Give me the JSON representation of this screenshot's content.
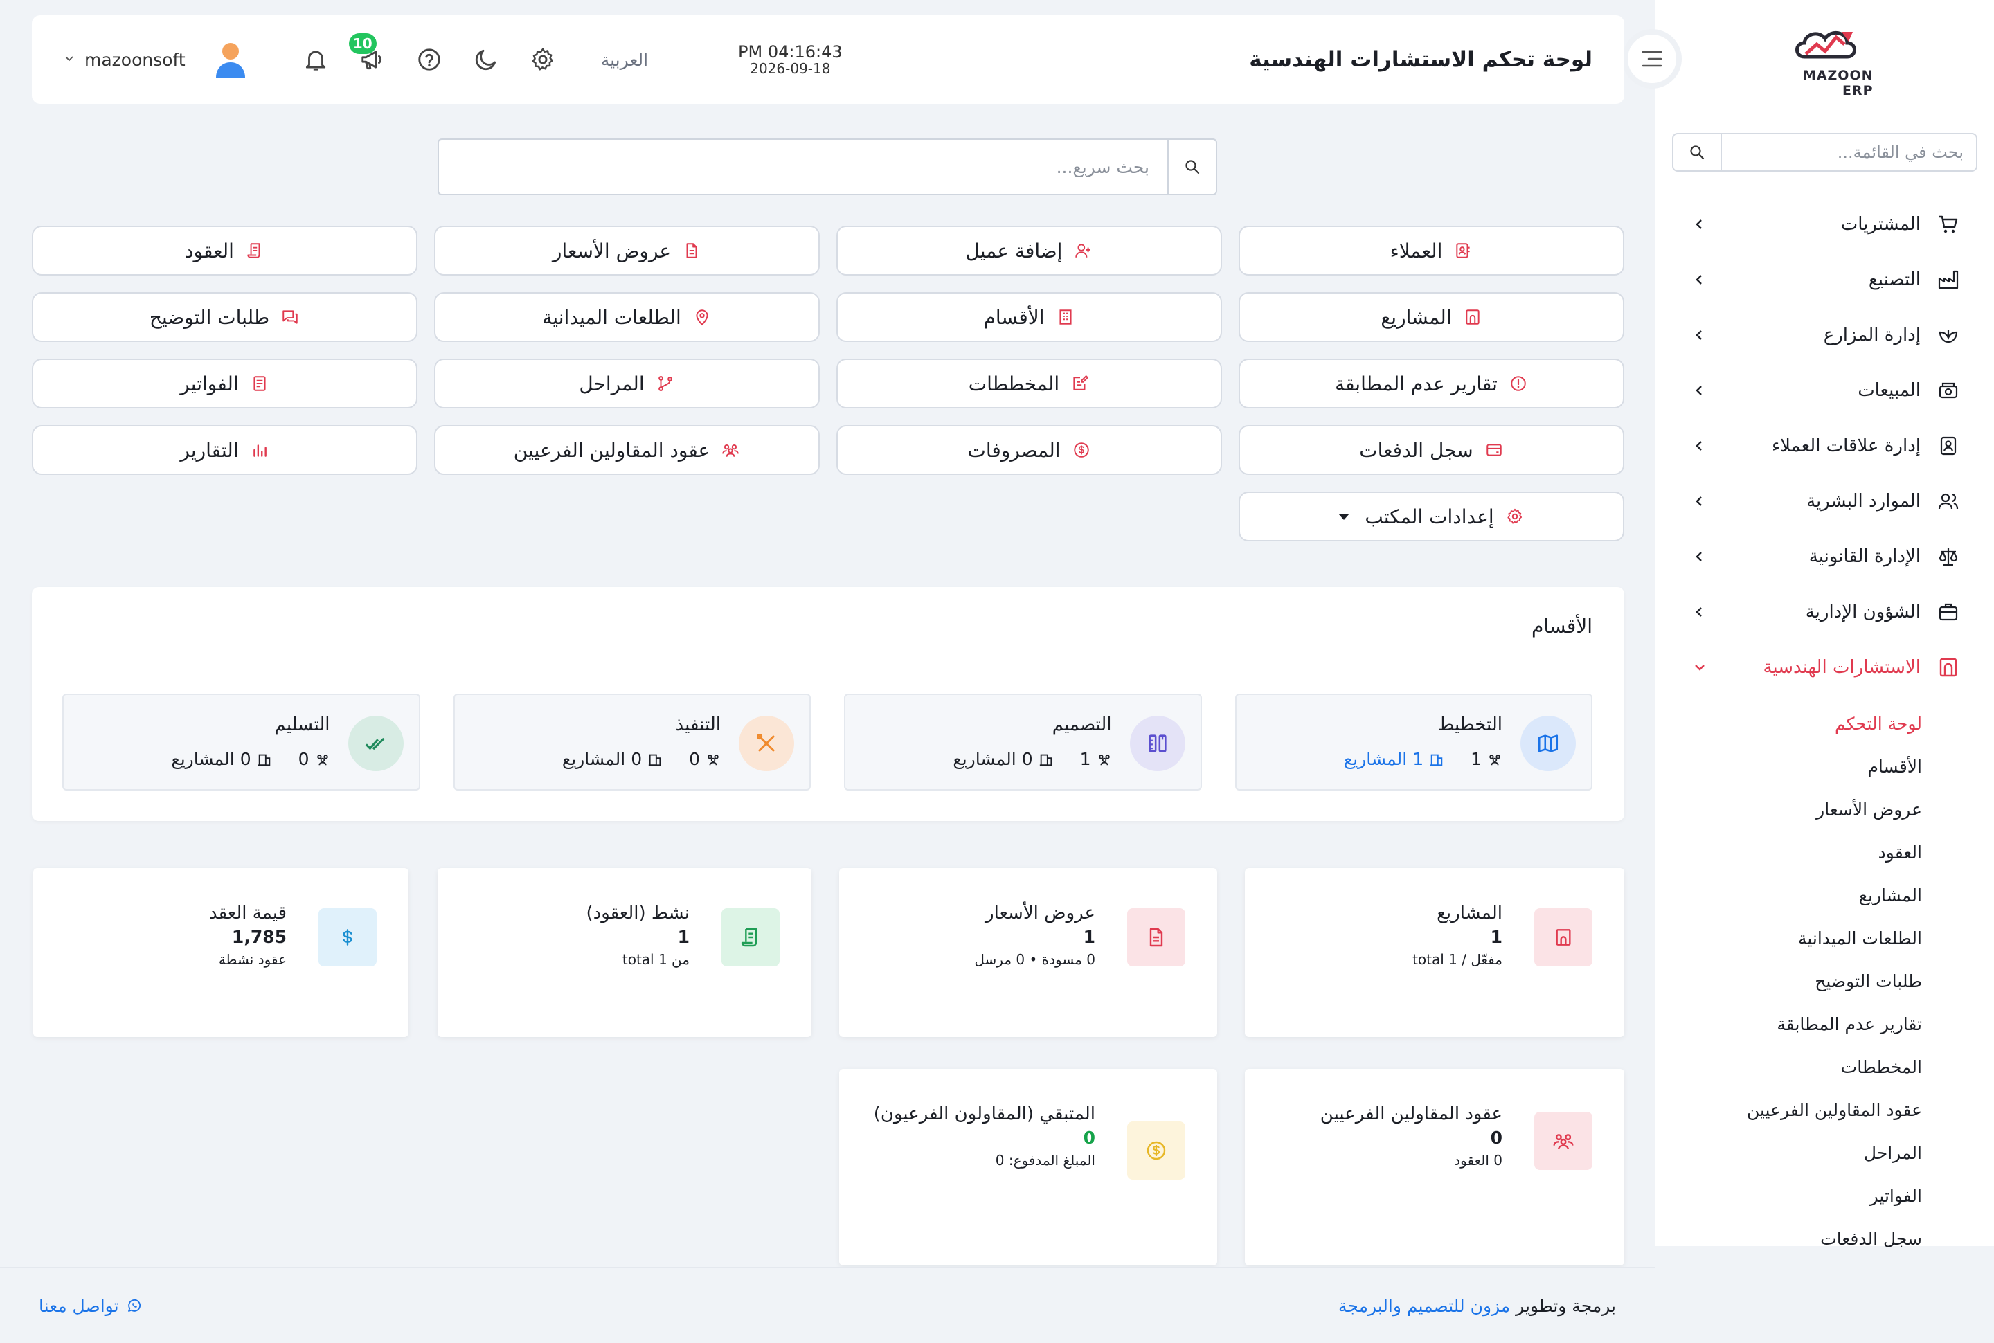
{
  "brand": {
    "logo_text": "MAZOON ERP",
    "logo_tagline": "ERP"
  },
  "sidebar": {
    "search_placeholder": "بحث في القائمة...",
    "items": [
      {
        "label": "المشتريات"
      },
      {
        "label": "التصنيع"
      },
      {
        "label": "إدارة المزارع"
      },
      {
        "label": "المبيعات"
      },
      {
        "label": "إدارة علاقات العملاء"
      },
      {
        "label": "الموارد البشرية"
      },
      {
        "label": "الإدارة القانونية"
      },
      {
        "label": "الشؤون الإدارية"
      },
      {
        "label": "الاستشارات الهندسية"
      }
    ],
    "subitems": [
      {
        "label": "لوحة التحكم"
      },
      {
        "label": "الأقسام"
      },
      {
        "label": "عروض الأسعار"
      },
      {
        "label": "العقود"
      },
      {
        "label": "المشاريع"
      },
      {
        "label": "الطلعات الميدانية"
      },
      {
        "label": "طلبات التوضيح"
      },
      {
        "label": "تقارير عدم المطابقة"
      },
      {
        "label": "المخططات"
      },
      {
        "label": "عقود المقاولين الفرعيين"
      },
      {
        "label": "المراحل"
      },
      {
        "label": "الفواتير"
      },
      {
        "label": "سجل الدفعات"
      }
    ]
  },
  "header": {
    "title": "لوحة تحكم الاستشارات الهندسية",
    "time": "PM 04:16:43",
    "date": "2026-09-18",
    "language": "العربية",
    "notification_count": "10",
    "username": "mazoonsoft"
  },
  "quick_search": {
    "placeholder": "بحث سريع..."
  },
  "quick_links": [
    {
      "label": "العملاء"
    },
    {
      "label": "إضافة عميل"
    },
    {
      "label": "عروض الأسعار"
    },
    {
      "label": "العقود"
    },
    {
      "label": "المشاريع"
    },
    {
      "label": "الأقسام"
    },
    {
      "label": "الطلعات الميدانية"
    },
    {
      "label": "طلبات التوضيح"
    },
    {
      "label": "تقارير عدم المطابقة"
    },
    {
      "label": "المخططات"
    },
    {
      "label": "المراحل"
    },
    {
      "label": "الفواتير"
    },
    {
      "label": "سجل الدفعات"
    },
    {
      "label": "المصروفات"
    },
    {
      "label": "عقود المقاولين الفرعيين"
    },
    {
      "label": "التقارير"
    },
    {
      "label": "إعدادات المكتب"
    }
  ],
  "departments": {
    "title": "الأقسام",
    "items": [
      {
        "name": "التخطيط",
        "people": "1",
        "projects": "1",
        "projects_label": "المشاريع"
      },
      {
        "name": "التصميم",
        "people": "1",
        "projects": "0",
        "projects_label": "المشاريع"
      },
      {
        "name": "التنفيذ",
        "people": "0",
        "projects": "0",
        "projects_label": "المشاريع"
      },
      {
        "name": "التسليم",
        "people": "0",
        "projects": "0",
        "projects_label": "المشاريع"
      }
    ]
  },
  "stats": [
    {
      "title": "المشاريع",
      "value": "1",
      "sub": "مفعّل / total 1"
    },
    {
      "title": "عروض الأسعار",
      "value": "1",
      "sub": "0 مسودة • 0 مرسل"
    },
    {
      "title": "نشط (العقود)",
      "value": "1",
      "sub": "من 1 total"
    },
    {
      "title": "قيمة العقد",
      "value": "1,785",
      "sub": "عقود نشطة"
    },
    {
      "title": "عقود المقاولين الفرعيين",
      "value": "0",
      "sub": "0 العقود"
    },
    {
      "title": "المتبقي (المقاولون الفرعيون)",
      "value": "0",
      "sub": "المبلغ المدفوع: 0"
    }
  ],
  "footer": {
    "credit_prefix": "برمجة وتطوير",
    "credit_link": "مزون للتصميم والبرمجة",
    "contact": "تواصل معنا"
  },
  "colors": {
    "accent_red": "#e03a4f",
    "link_blue": "#1a73e8",
    "badge_green": "#22c55e",
    "value_green": "#16a34a"
  }
}
